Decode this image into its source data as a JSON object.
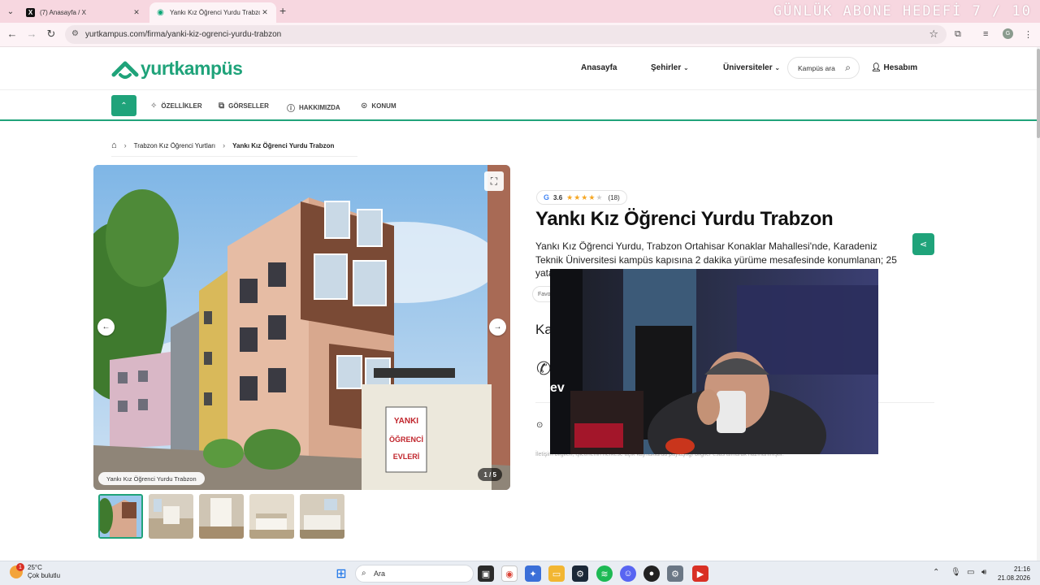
{
  "browser": {
    "tabs": [
      {
        "title": "(7) Anasayfa / X",
        "favicon": "x-logo-icon",
        "active": false
      },
      {
        "title": "Yankı Kız Öğrenci Yurdu Trabzo",
        "favicon": "yurtkampus-logo-icon",
        "active": true
      }
    ],
    "overlay_text": "GÜNLÜK ABONE HEDEFİ 7 / 10",
    "url": "yurtkampus.com/firma/yanki-kiz-ogrenci-yurdu-trabzon",
    "profile_initial": "G"
  },
  "site": {
    "logo_text": "yurtkampüs",
    "nav": {
      "home": "Anasayfa",
      "cities": "Şehirler",
      "universities": "Üniversiteler",
      "search_placeholder": "Kampüs ara",
      "account": "Hesabım"
    },
    "subnav": {
      "features": "ÖZELLİKLER",
      "images": "GÖRSELLER",
      "about": "HAKKIMIZDA",
      "location": "KONUM"
    },
    "breadcrumb": {
      "parent": "Trabzon Kız Öğrenci Yurtları",
      "current": "Yankı Kız Öğrenci Yurdu Trabzon"
    }
  },
  "gallery": {
    "caption": "Yankı Kız Öğrenci Yurdu Trabzon",
    "counter": "1 / 5",
    "sign_lines": [
      "YANKI",
      "ÖĞRENCİ",
      "EVLERİ"
    ],
    "thumbnail_count": 5,
    "selected_index": 0
  },
  "info": {
    "rating_source": "G",
    "rating": "3.6",
    "rating_value": 3.6,
    "review_count": "(18)",
    "title": "Yankı Kız Öğrenci Yurdu Trabzon",
    "description": "Yankı Kız Öğrenci Yurdu, Trabzon Ortahisar Konaklar Mahallesi'nde, Karadeniz Teknik Üniversitesi kampüs kapısına 2 dakika yürüme mesafesinde konumlanan; 25 yatak kap",
    "fav_chip": "Favo",
    "partial_heading": "Ka",
    "disclaimer": "İletişim bilgileri, işletmenin herkese açık kaynaklarda paylaştığı bilgiler esas alınarak hazırlanmıştır."
  },
  "taskbar": {
    "temperature": "25°C",
    "weather": "Çok bulutlu",
    "weather_badge": "1",
    "search_placeholder": "Ara",
    "time": "21:16",
    "date": "21.08.2026"
  },
  "colors": {
    "brand_green": "#1fa37a",
    "tab_bar_pink": "#f7d7e0",
    "star_gold": "#f5a623"
  }
}
